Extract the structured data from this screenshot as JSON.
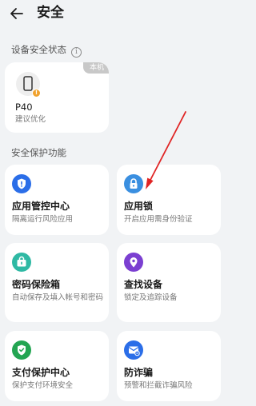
{
  "header": {
    "title": "安全"
  },
  "device_section": {
    "label": "设备安全状态",
    "device": {
      "badge": "本机",
      "name": "P40",
      "status": "建议优化"
    }
  },
  "protection_section": {
    "label": "安全保护功能",
    "items": [
      {
        "name": "应用管控中心",
        "desc": "隔离运行风险应用",
        "icon": "shield-icon",
        "color": "#2b6ee8"
      },
      {
        "name": "应用锁",
        "desc": "开启应用需身份验证",
        "icon": "lock-icon",
        "color": "#3a8fe0"
      },
      {
        "name": "密码保险箱",
        "desc": "自动保存及填入帐号和密码",
        "icon": "safe-icon",
        "color": "#2fb9a4"
      },
      {
        "name": "查找设备",
        "desc": "锁定及追踪设备",
        "icon": "location-pin-icon",
        "color": "#7b3fd1"
      },
      {
        "name": "支付保护中心",
        "desc": "保护支付环境安全",
        "icon": "payment-shield-icon",
        "color": "#23a552"
      },
      {
        "name": "防诈骗",
        "desc": "预警和拦截诈骗风险",
        "icon": "anti-fraud-icon",
        "color": "#2b6ee8"
      }
    ]
  },
  "annotation": {
    "icon": "red-arrow-icon",
    "color": "#e02424"
  }
}
